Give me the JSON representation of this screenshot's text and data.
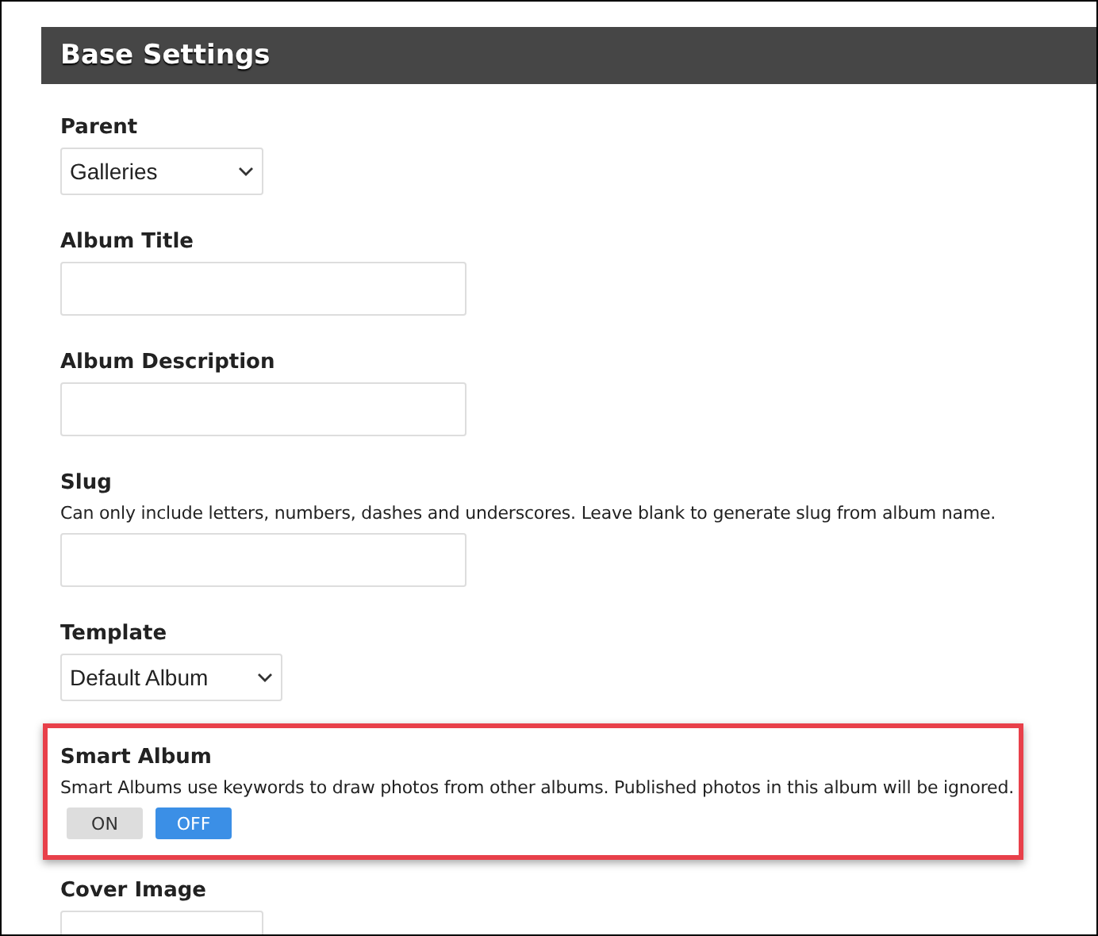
{
  "header": {
    "title": "Base Settings"
  },
  "fields": [
    {
      "kind": "select",
      "label": "Parent",
      "value": "Galleries",
      "highlighted": false
    },
    {
      "kind": "text",
      "label": "Album Title",
      "highlighted": false
    },
    {
      "kind": "text",
      "label": "Album Description",
      "highlighted": false
    },
    {
      "kind": "text",
      "label": "Slug",
      "hint": "Can only include letters, numbers, dashes and underscores. Leave blank to generate slug from album name.",
      "highlighted": false
    },
    {
      "kind": "select",
      "label": "Template",
      "value": "Default Album",
      "highlighted": false
    },
    {
      "kind": "toggle",
      "label": "Smart Album",
      "hint": "Smart Albums use keywords to draw photos from other albums. Published photos in this album will be ignored.",
      "highlighted": true,
      "options": [
        {
          "label": "ON",
          "selected": false
        },
        {
          "label": "OFF",
          "selected": true
        }
      ]
    },
    {
      "kind": "select",
      "label": "Cover Image",
      "highlighted": false
    }
  ]
}
